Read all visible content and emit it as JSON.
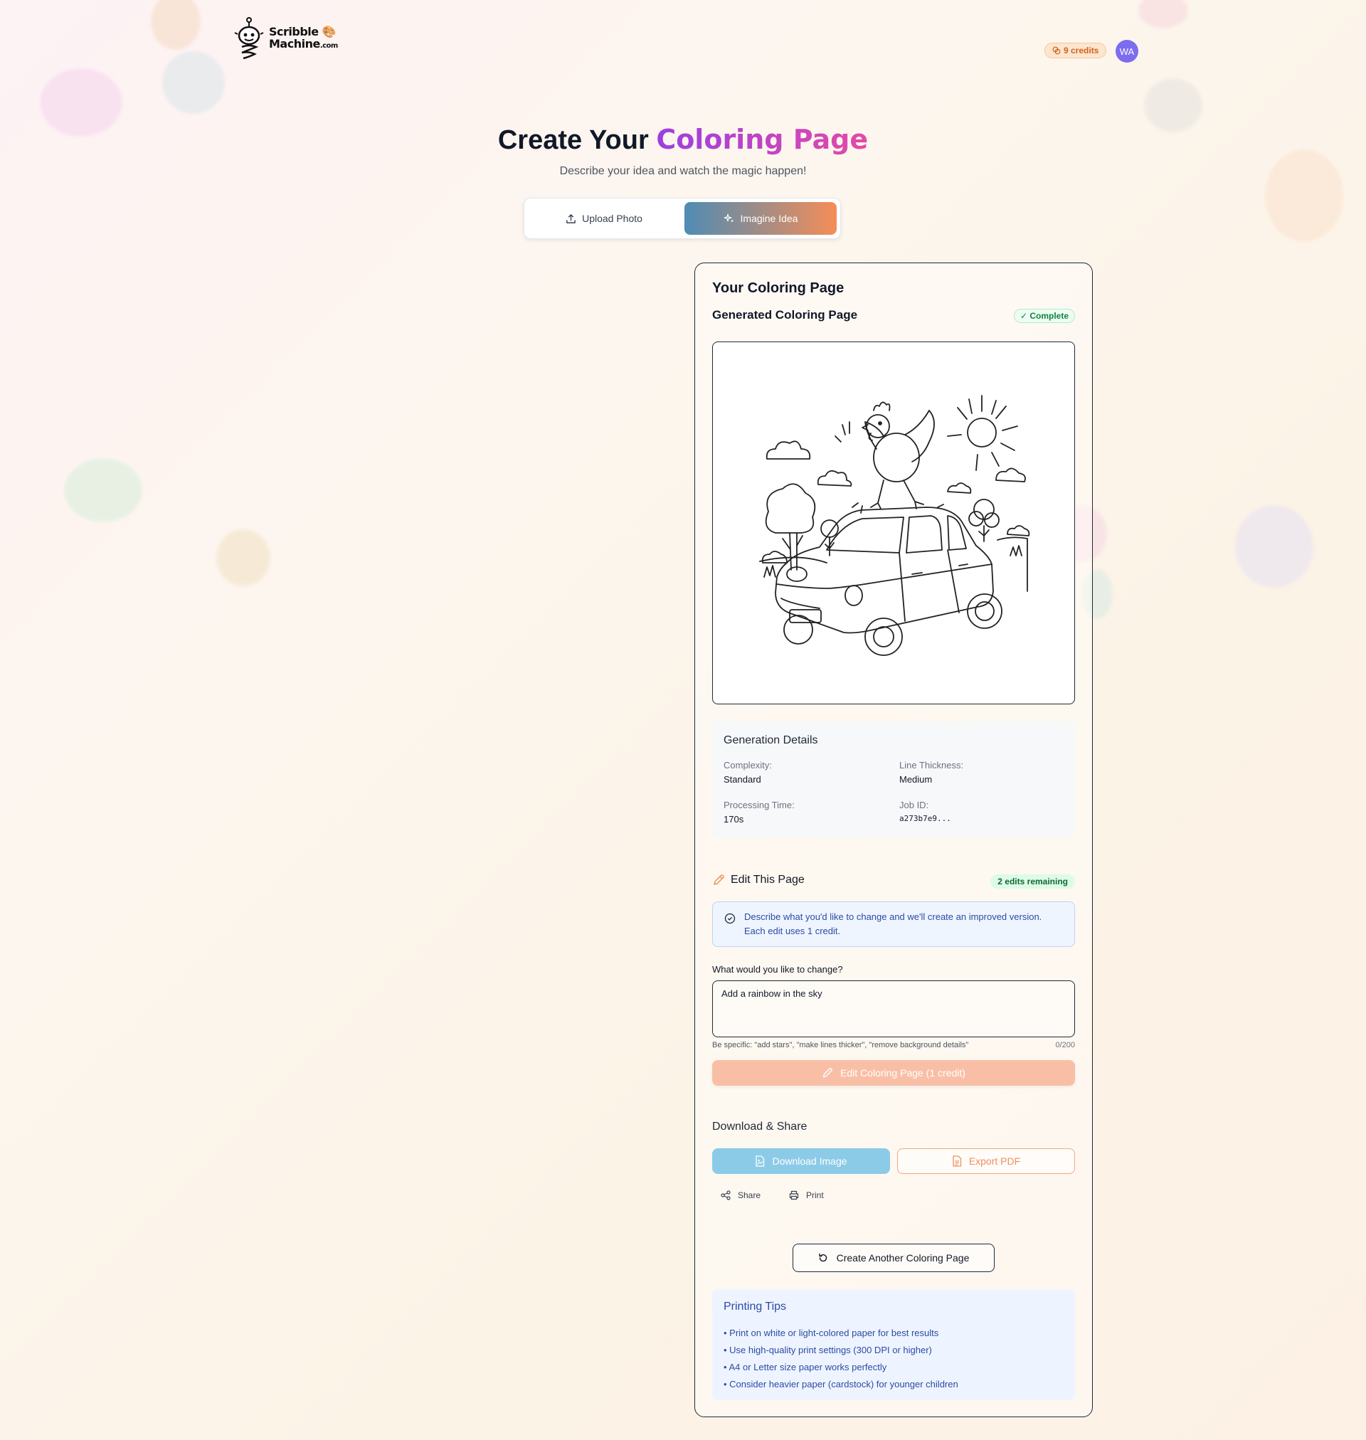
{
  "brand": {
    "name_line1": "Scribble",
    "name_line2": "Machine",
    "name_suffix": ".com"
  },
  "header": {
    "credits_label": "9 credits",
    "avatar_initials": "WA"
  },
  "hero": {
    "title_part1": "Create Your ",
    "title_accent": "Coloring Page",
    "subtitle": "Describe your idea and watch the magic happen!"
  },
  "mode_toggle": {
    "upload_label": "Upload Photo",
    "imagine_label": "Imagine Idea",
    "selected": "Imagine Idea"
  },
  "result": {
    "title": "Your Coloring Page",
    "subtitle": "Generated Coloring Page",
    "status_badge": "✓ Complete"
  },
  "generation_details": {
    "title": "Generation Details",
    "complexity_label": "Complexity:",
    "complexity_value": "Standard",
    "line_thickness_label": "Line Thickness:",
    "line_thickness_value": "Medium",
    "processing_time_label": "Processing Time:",
    "processing_time_value": "170s",
    "job_id_label": "Job ID:",
    "job_id_value": "a273b7e9..."
  },
  "edit": {
    "title": "Edit This Page",
    "edits_badge": "2 edits remaining",
    "info_text": "Describe what you'd like to change and we'll create an improved version. Each edit uses 1 credit.",
    "field_label": "What would you like to change?",
    "field_value": "Add a rainbow in the sky",
    "hint": "Be specific: \"add stars\", \"make lines thicker\", \"remove background details\"",
    "char_count": "0/200",
    "submit_label": "Edit Coloring Page (1 credit)"
  },
  "download": {
    "title": "Download & Share",
    "download_label": "Download Image",
    "export_label": "Export PDF",
    "share_label": "Share",
    "print_label": "Print"
  },
  "create_another_label": "Create Another Coloring Page",
  "printing_tips": {
    "title": "Printing Tips",
    "items": [
      "• Print on white or light-colored paper for best results",
      "• Use high-quality print settings (300 DPI or higher)",
      "• A4 or Letter size paper works perfectly",
      "• Consider heavier paper (cardstock) for younger children"
    ]
  },
  "colors": {
    "accent_gradient_start": "#4e8cb4",
    "accent_gradient_end": "#f58d57",
    "title_gradient_start": "#9b3fe0",
    "title_gradient_end": "#e34aa8",
    "success": "#15803d",
    "info": "#2b4aa5"
  }
}
